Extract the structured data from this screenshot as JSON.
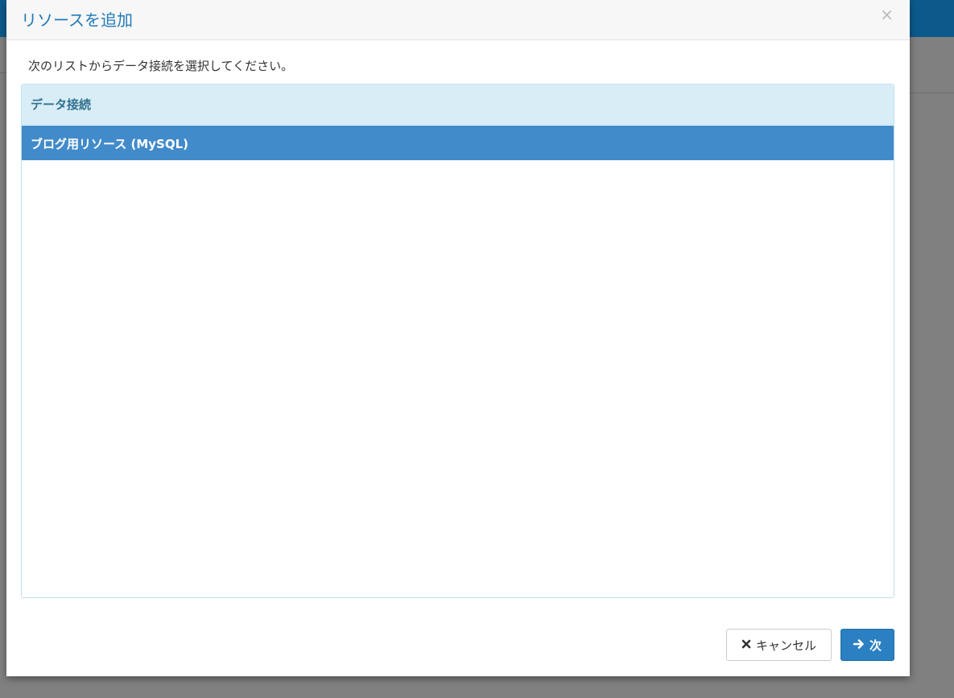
{
  "dialog": {
    "title": "リソースを追加",
    "close_symbol": "×",
    "instruction": "次のリストからデータ接続を選択してください。"
  },
  "panel": {
    "heading": "データ接続",
    "items": [
      {
        "label": "ブログ用リソース (MySQL)",
        "selected": true
      }
    ]
  },
  "footer": {
    "cancel_label": "キャンセル",
    "cancel_icon": "times-icon",
    "next_label": "次",
    "next_icon": "arrow-right-icon"
  },
  "colors": {
    "title": "#1f7ab8",
    "selected_row": "#428bca",
    "panel_heading_bg": "#d9edf7",
    "primary_button": "#2a80c1",
    "topbar": "#0c5a8c"
  }
}
